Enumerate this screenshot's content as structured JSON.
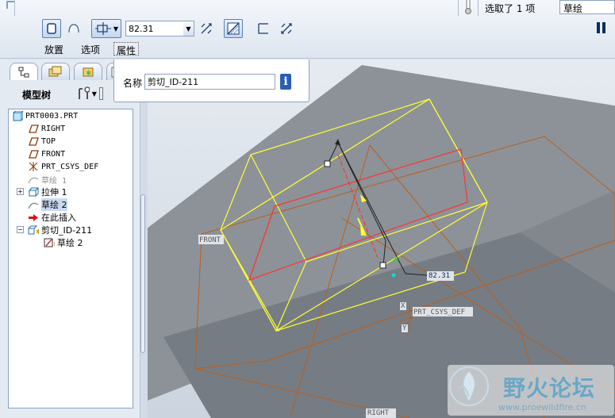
{
  "dashboard": {
    "tabs": [
      "放置",
      "选项",
      "属性"
    ],
    "dimension_value": "82.31",
    "selection_status": "选取了 1 项",
    "filter_value": "草绘"
  },
  "properties": {
    "name_label": "名称",
    "name_value": "剪切_ID-211"
  },
  "navigator": {
    "title": "模型树",
    "tree": [
      {
        "label": "PRT0003.PRT",
        "icon": "part-icon",
        "state": "normal"
      },
      {
        "label": "RIGHT",
        "icon": "datum-plane-icon",
        "state": "normal"
      },
      {
        "label": "TOP",
        "icon": "datum-plane-icon",
        "state": "normal"
      },
      {
        "label": "FRONT",
        "icon": "datum-plane-icon",
        "state": "normal"
      },
      {
        "label": "PRT_CSYS_DEF",
        "icon": "csys-icon",
        "state": "normal"
      },
      {
        "label": "草绘 1",
        "icon": "sketch-icon",
        "state": "dim"
      },
      {
        "label": "拉伸 1",
        "icon": "extrude-icon",
        "state": "normal"
      },
      {
        "label": "草绘 2",
        "icon": "sketch-icon",
        "state": "selected"
      },
      {
        "label": "在此插入",
        "icon": "insert-arrow-icon",
        "state": "normal"
      },
      {
        "label": "剪切_ID-211",
        "icon": "cut-icon",
        "state": "normal"
      },
      {
        "label": "草绘 2",
        "icon": "internal-sketch-icon",
        "state": "normal"
      }
    ]
  },
  "viewport": {
    "datum_labels": [
      "FRONT",
      "PRT_CSYS_DEF",
      "RIGHT"
    ],
    "axis_labels": [
      "X",
      "Y"
    ],
    "dimension_label": "82.31"
  },
  "watermark": {
    "title": "野火论坛",
    "url": "www.proewildfire.cn"
  },
  "colors": {
    "preview": "#ffff33",
    "sketch": "#ff3333",
    "datum": "#b85f20",
    "solid_top": "#8d9298",
    "solid_front": "#767c83"
  }
}
